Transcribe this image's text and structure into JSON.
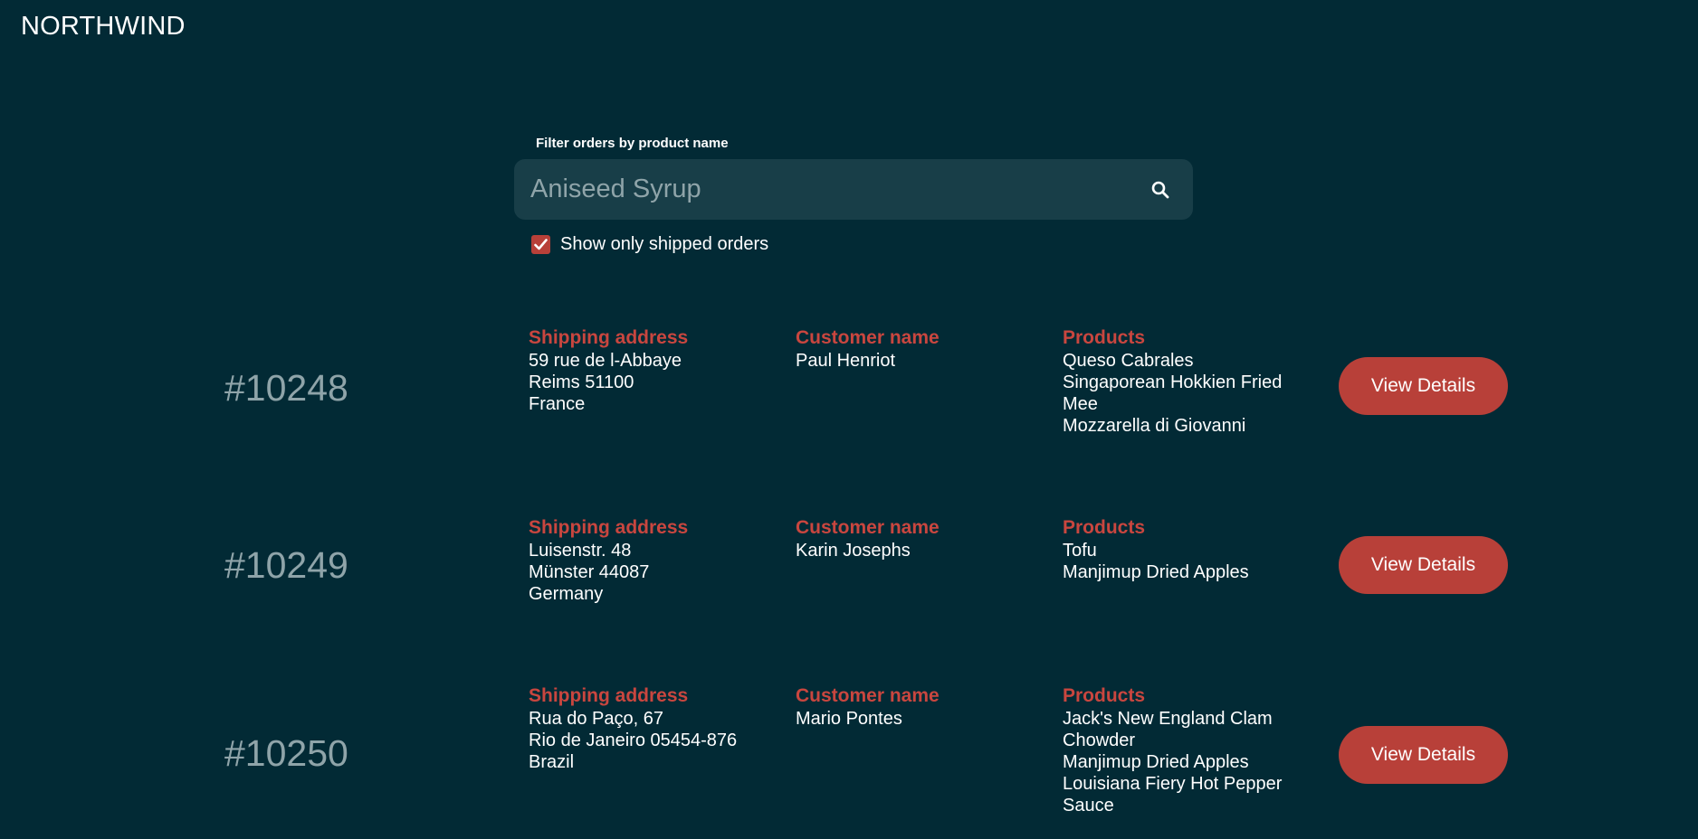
{
  "brand": "NORTHWIND",
  "filter": {
    "label": "Filter orders by product name",
    "placeholder": "Aniseed Syrup",
    "value": "",
    "checkbox_label": "Show only shipped orders",
    "checkbox_checked": true
  },
  "colors": {
    "background": "#022a35",
    "accent": "#c9463f",
    "button": "#b84039",
    "search_bg": "#183e48",
    "muted": "#8fa4a9"
  },
  "column_headers": {
    "address": "Shipping address",
    "customer": "Customer name",
    "products": "Products"
  },
  "orders": [
    {
      "id": "#10248",
      "address": [
        "59 rue de l-Abbaye",
        "Reims 51100",
        "France"
      ],
      "customer": "Paul Henriot",
      "products": [
        "Queso Cabrales",
        "Singaporean Hokkien Fried Mee",
        "Mozzarella di Giovanni"
      ],
      "button_label": "View Details"
    },
    {
      "id": "#10249",
      "address": [
        "Luisenstr. 48",
        "Münster 44087",
        "Germany"
      ],
      "customer": "Karin Josephs",
      "products": [
        "Tofu",
        "Manjimup Dried Apples"
      ],
      "button_label": "View Details"
    },
    {
      "id": "#10250",
      "address": [
        "Rua do Paço, 67",
        "Rio de Janeiro 05454-876",
        "Brazil"
      ],
      "customer": "Mario Pontes",
      "products": [
        "Jack's New England Clam Chowder",
        "Manjimup Dried Apples",
        "Louisiana Fiery Hot Pepper Sauce"
      ],
      "button_label": "View Details"
    }
  ]
}
